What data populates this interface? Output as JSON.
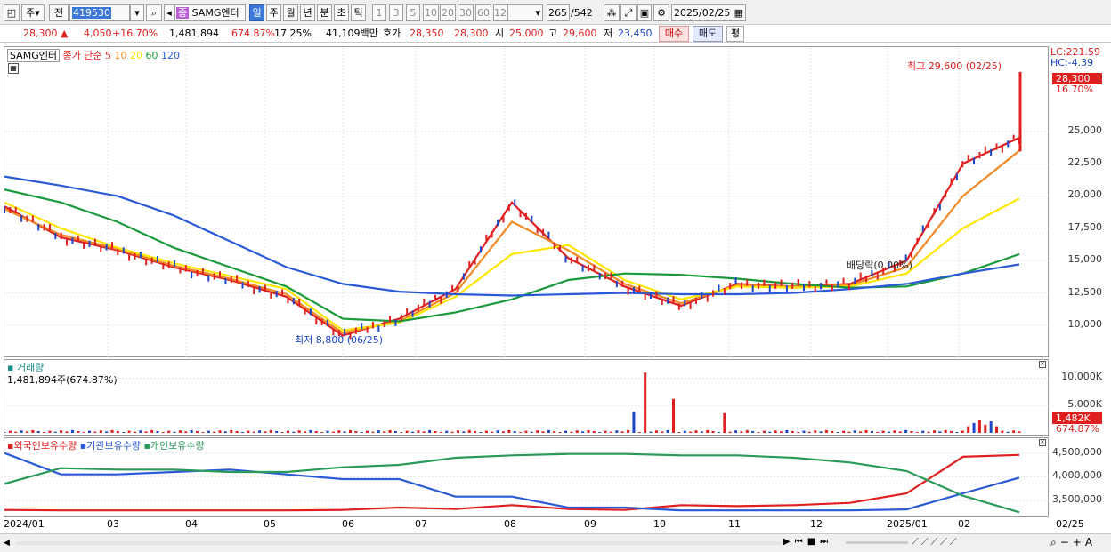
{
  "toolbar": {
    "period_label": "주",
    "prev_label": "전",
    "code": "419530",
    "stock_name": "SAMG엔터",
    "stock_badge": "종",
    "interval_tabs": [
      "일",
      "주",
      "월",
      "년",
      "분",
      "초",
      "틱"
    ],
    "interval_selected": "일",
    "minute_presets": [
      "1",
      "3",
      "5",
      "10",
      "20",
      "30",
      "60",
      "120"
    ],
    "count_current": "265",
    "count_total": "/542",
    "date": "2025/02/25"
  },
  "quote": {
    "price": "28,300",
    "change": "4,050",
    "change_arrow": "▲",
    "change_pct": "+16.70%",
    "volume": "1,481,894",
    "volume_ratio": "674.87%",
    "turnover": "17.25%",
    "amount": "41,109백만",
    "bid_label": "호가",
    "bid": "28,350",
    "ask": "28,300",
    "open_label": "시",
    "open": "25,000",
    "high_label": "고",
    "high": "29,600",
    "low_label": "저",
    "low": "23,450",
    "buy_label": "매수",
    "sell_label": "매도",
    "avg_label": "평"
  },
  "price_panel": {
    "name": "SAMG엔터",
    "legend_prefix": "종가 단순",
    "ma_periods": [
      "5",
      "10",
      "20",
      "60",
      "120"
    ],
    "ma_colors": [
      "#e02020",
      "#f08a24",
      "#ffe600",
      "#1a9a3a",
      "#2a5ad8"
    ],
    "high_note": "최고 29,600 (02/25)",
    "low_note": "최저 8,800 (06/25)",
    "dividend_note": "배당락(0.00%)",
    "lc": "LC:221.59",
    "hc": "HC:-4.39",
    "last_price": "28,300",
    "last_pct": "16.70%",
    "y_ticks": [
      "25,000",
      "22,500",
      "20,000",
      "17,500",
      "15,000",
      "12,500",
      "10,000"
    ]
  },
  "volume_panel": {
    "title": "거래량",
    "value": "1,481,894주(674.87%)",
    "y_ticks": [
      "10,000K",
      "5,000K"
    ],
    "last_value": "1,482K",
    "last_pct": "674.87%"
  },
  "holding_panel": {
    "labels": [
      "외국인보유수량",
      "기관보유수량",
      "개인보유수량"
    ],
    "colors": [
      "#e02020",
      "#2a5ad8",
      "#2a9a5a"
    ],
    "y_ticks": [
      "4,500,000",
      "4,000,000",
      "3,500,000"
    ]
  },
  "x_axis": {
    "labels": [
      "2024/01",
      "03",
      "04",
      "05",
      "06",
      "07",
      "08",
      "09",
      "10",
      "11",
      "12",
      "2025/01",
      "02"
    ],
    "right_label": "02/25"
  },
  "chart_data": {
    "type": "line",
    "title": "SAMG엔터",
    "x_labels": [
      "2024/01",
      "03",
      "04",
      "05",
      "06",
      "07",
      "08",
      "09",
      "10",
      "11",
      "12",
      "2025/01",
      "02"
    ],
    "ylim": [
      8000,
      30000
    ],
    "series": [
      {
        "name": "5",
        "values": [
          19200,
          16800,
          15800,
          14500,
          13500,
          12200,
          9200,
          10500,
          12800,
          19500,
          15200,
          13000,
          11500,
          13200,
          13000,
          13200,
          15000,
          22500,
          24500
        ]
      },
      {
        "name": "10",
        "values": [
          19000,
          17000,
          15900,
          14600,
          13600,
          12400,
          9400,
          10300,
          12500,
          18000,
          15800,
          13200,
          11700,
          13100,
          13000,
          13100,
          14500,
          20000,
          23500
        ]
      },
      {
        "name": "20",
        "values": [
          19500,
          17500,
          16000,
          14800,
          13800,
          12800,
          9600,
          10200,
          12200,
          15500,
          16200,
          13500,
          12000,
          13000,
          12900,
          13000,
          14000,
          17500,
          19800
        ]
      },
      {
        "name": "60",
        "values": [
          20500,
          19500,
          18000,
          16000,
          14500,
          13000,
          10500,
          10300,
          11000,
          12000,
          13500,
          14000,
          13900,
          13600,
          13200,
          12900,
          13000,
          14000,
          15500
        ]
      },
      {
        "name": "120",
        "values": [
          21500,
          20800,
          20000,
          18500,
          16500,
          14500,
          13200,
          12600,
          12400,
          12300,
          12400,
          12500,
          12400,
          12400,
          12500,
          12800,
          13200,
          14000,
          14700
        ]
      }
    ],
    "annotations": [
      "최고 29,600 (02/25)",
      "최저 8,800 (06/25)",
      "배당락(0.00%)"
    ]
  }
}
